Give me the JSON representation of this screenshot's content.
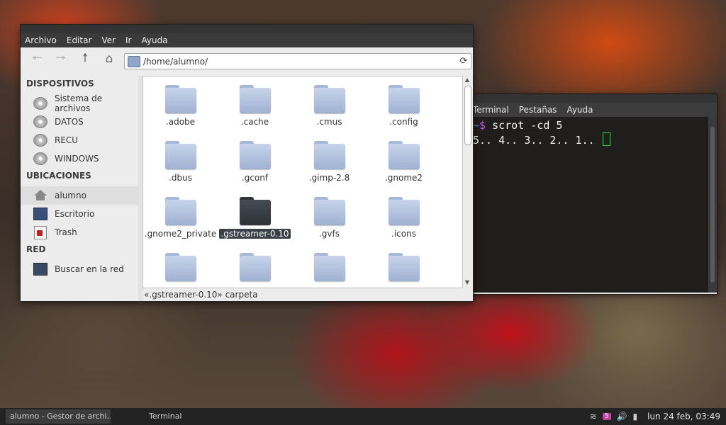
{
  "file_manager": {
    "menu": [
      "Archivo",
      "Editar",
      "Ver",
      "Ir",
      "Ayuda"
    ],
    "location": "/home/alumno/",
    "sidebar": {
      "sections": [
        {
          "title": "DISPOSITIVOS",
          "items": [
            "Sistema de archivos",
            "DATOS",
            "RECU",
            "WINDOWS"
          ]
        },
        {
          "title": "UBICACIONES",
          "items": [
            "alumno",
            "Escritorio",
            "Trash"
          ]
        },
        {
          "title": "RED",
          "items": [
            "Buscar en la red"
          ]
        }
      ]
    },
    "folders": [
      ".adobe",
      ".cache",
      ".cmus",
      ".config",
      ".dbus",
      ".gconf",
      ".gimp-2.8",
      ".gnome2",
      ".gnome2_private",
      ".gstreamer-0.10",
      ".gvfs",
      ".icons"
    ],
    "selected_folder": ".gstreamer-0.10",
    "status": "«.gstreamer-0.10» carpeta"
  },
  "terminal": {
    "menu": [
      "Terminal",
      "Pestañas",
      "Ayuda"
    ],
    "prompt_path": "~",
    "prompt_symbol": "$",
    "command": "scrot -cd 5",
    "output": "5.. 4.. 3.. 2.. 1.."
  },
  "taskbar": {
    "tasks": [
      "alumno - Gestor de archi...",
      "Terminal"
    ],
    "notification_count": "5",
    "clock": "lun 24 feb, 03:49"
  }
}
